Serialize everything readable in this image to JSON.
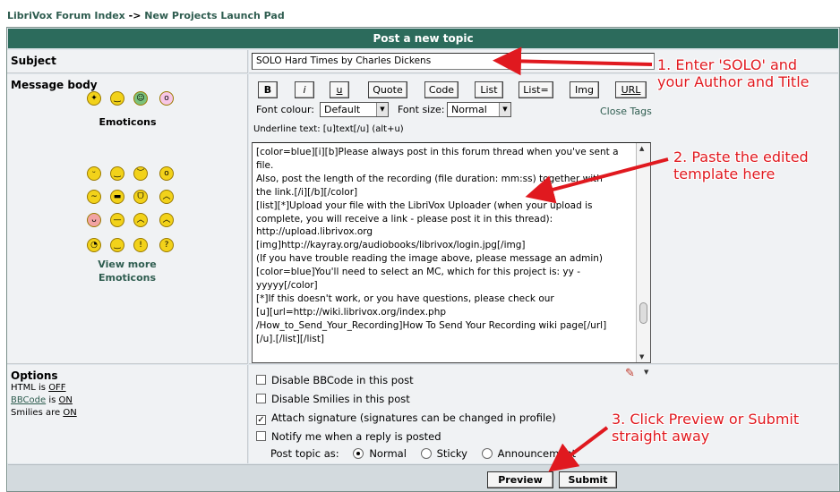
{
  "breadcrumb": {
    "index": "LibriVox Forum Index",
    "sep": "->",
    "current": "New Projects Launch Pad"
  },
  "header": {
    "title": "Post a new topic"
  },
  "subject": {
    "label": "Subject",
    "value": "SOLO Hard Times by Charles Dickens"
  },
  "message": {
    "label": "Message body"
  },
  "emoticons": {
    "title": "Emoticons",
    "icons": [
      "grin-icon",
      "smile-icon",
      "sad-icon",
      "surprised-icon",
      "confused-icon",
      "cool-icon",
      "laugh-icon",
      "mad-icon",
      "razz-icon",
      "neutral-icon",
      "evil-icon",
      "twisted-icon",
      "rolleyes-icon",
      "wink-icon",
      "exclaim-icon",
      "question-icon",
      "idea-icon",
      "arrow-icon",
      "green-icon",
      "eek-icon"
    ],
    "view_more": "View more Emoticons"
  },
  "toolbar": {
    "buttons": [
      "B",
      "i",
      "u",
      "Quote",
      "Code",
      "List",
      "List=",
      "Img",
      "URL"
    ]
  },
  "font": {
    "colour_label": "Font colour:",
    "colour_value": "Default",
    "size_label": "Font size:",
    "size_value": "Normal",
    "close_tags": "Close Tags"
  },
  "hint": "Underline text: [u]text[/u]  (alt+u)",
  "body_lines": [
    "[color=blue][i][b]Please always post in this forum thread when you've sent a",
    "file.",
    "Also, post the length of the recording (file duration: mm:ss) together with",
    "the link.[/i][/b][/color]",
    "[list][*]Upload your file with the LibriVox Uploader (when your upload is",
    "complete, you will receive a link - please post it in this thread):",
    "http://upload.librivox.org",
    "[img]http://kayray.org/audiobooks/librivox/login.jpg[/img]",
    "(If you have trouble reading the image above, please message an admin)",
    "[color=blue]You'll need to select an MC, which for this project is: yy -",
    "yyyyy[/color]",
    "[*]If this doesn't work, or you have questions, please check our",
    "[u][url=http://wiki.librivox.org/index.php",
    "/How_to_Send_Your_Recording]How To Send Your Recording wiki page[/url]",
    "[/u].[/list][/list]"
  ],
  "options": {
    "label": "Options",
    "html": {
      "prefix": "HTML is ",
      "value": "OFF"
    },
    "bbcode": {
      "link": "BBCode",
      "mid": " is ",
      "value": "ON"
    },
    "smilies": {
      "prefix": "Smilies are ",
      "value": "ON"
    },
    "checks": [
      {
        "label": "Disable BBCode in this post",
        "checked": false
      },
      {
        "label": "Disable Smilies in this post",
        "checked": false
      },
      {
        "label": "Attach signature (signatures can be changed in profile)",
        "checked": true
      },
      {
        "label": "Notify me when a reply is posted",
        "checked": false
      }
    ],
    "post_as": {
      "label": "Post topic as:",
      "normal": "Normal",
      "sticky": "Sticky",
      "announcement": "Announcement",
      "selected": "Normal"
    }
  },
  "footer": {
    "preview": "Preview",
    "submit": "Submit"
  },
  "annotations": {
    "a1": [
      "1. Enter 'SOLO' and",
      "your Author and Title"
    ],
    "a2": [
      "2. Paste the edited",
      "template here"
    ],
    "a3": [
      "3. Click Preview or Submit",
      "straight away"
    ],
    "color": "#e0191f"
  }
}
